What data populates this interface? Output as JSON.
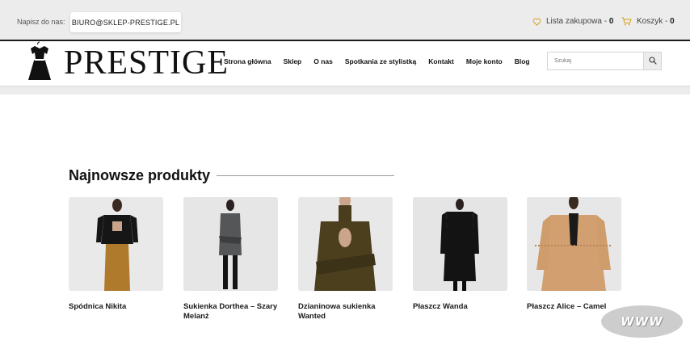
{
  "topbar": {
    "contact_label": "Napisz do nas:",
    "email": "BIURO@SKLEP-PRESTIGE.PL",
    "wishlist_label": "Lista zakupowa - ",
    "wishlist_count": "0",
    "cart_label": "Koszyk - ",
    "cart_count": "0",
    "icon_color": "#d4a017"
  },
  "header": {
    "logo_text": "PRESTIGE",
    "nav": [
      {
        "label": "Strona główna"
      },
      {
        "label": "Sklep"
      },
      {
        "label": "O nas"
      },
      {
        "label": "Spotkania ze stylistką"
      },
      {
        "label": "Kontakt"
      },
      {
        "label": "Moje konto"
      },
      {
        "label": "Blog"
      }
    ],
    "search": {
      "placeholder": "Szukaj",
      "value": ""
    }
  },
  "section": {
    "title": "Najnowsze produkty"
  },
  "products": [
    {
      "name": "Spódnica Nikita",
      "icon": "skirt-photo"
    },
    {
      "name": "Sukienka Dorthea – Szary Melanż",
      "icon": "dress-photo"
    },
    {
      "name": "Dzianinowa sukienka Wanted",
      "icon": "knit-dress-photo"
    },
    {
      "name": "Płaszcz Wanda",
      "icon": "coat-photo"
    },
    {
      "name": "Płaszcz Alice – Camel",
      "icon": "camel-coat-photo"
    }
  ],
  "badge": {
    "text": "WWW"
  }
}
